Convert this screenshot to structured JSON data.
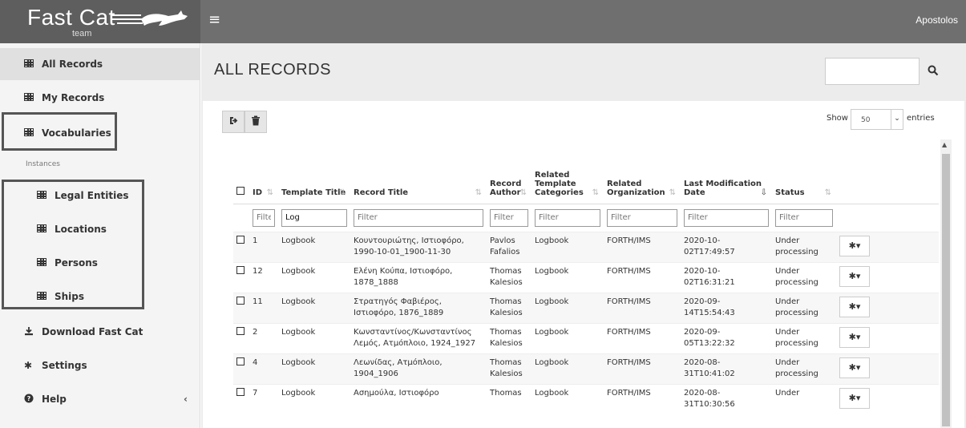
{
  "brand": {
    "name": "Fast Cat",
    "sub": "team"
  },
  "topbar": {
    "menu_icon": "hamburger-icon",
    "user": "Apostolos"
  },
  "sidebar": {
    "items": [
      {
        "label": "All Records",
        "icon": "table-icon"
      },
      {
        "label": "My Records",
        "icon": "table-icon"
      },
      {
        "label": "Vocabularies",
        "icon": "table-icon"
      }
    ],
    "section_label": "Instances",
    "instances": [
      {
        "label": "Legal Entities",
        "icon": "table-icon"
      },
      {
        "label": "Locations",
        "icon": "table-icon"
      },
      {
        "label": "Persons",
        "icon": "table-icon"
      },
      {
        "label": "Ships",
        "icon": "table-icon"
      }
    ],
    "bottom": [
      {
        "label": "Download Fast Cat",
        "icon": "download-icon"
      },
      {
        "label": "Settings",
        "icon": "gear-icon"
      },
      {
        "label": "Help",
        "icon": "question-icon",
        "chevron": "‹"
      }
    ]
  },
  "main": {
    "title": "ALL RECORDS",
    "search": {
      "value": "",
      "placeholder": ""
    },
    "toolbar": {
      "export_icon": "sign-in-icon",
      "delete_icon": "trash-icon"
    },
    "show": {
      "label": "Show",
      "value": "50",
      "suffix": "entries"
    },
    "table": {
      "columns": [
        "",
        "ID",
        "Template Title",
        "Record Title",
        "Record Author",
        "Related Template Categories",
        "Related Organization",
        "Last Modification Date",
        "Status",
        ""
      ],
      "filters": [
        "",
        "Filter",
        "Log",
        "Filter",
        "Filter",
        "Filter",
        "Filter",
        "Filter",
        "Filter",
        ""
      ],
      "rows": [
        {
          "id": "1",
          "template": "Logbook",
          "title": "Κουντουριώτης, Ιστιοφόρο, 1990-10-01_1900-11-30",
          "author": "Pavlos Fafalios",
          "category": "Logbook",
          "org": "FORTH/IMS",
          "date": "2020-10-02T17:49:57",
          "status": "Under processing"
        },
        {
          "id": "12",
          "template": "Logbook",
          "title": "Ελένη Κούπα, Ιστιοφόρο, 1878_1888",
          "author": "Thomas Kalesios",
          "category": "Logbook",
          "org": "FORTH/IMS",
          "date": "2020-10-02T16:31:21",
          "status": "Under processing"
        },
        {
          "id": "11",
          "template": "Logbook",
          "title": "Στρατηγός Φαβιέρος, Ιστιοφόρο, 1876_1889",
          "author": "Thomas Kalesios",
          "category": "Logbook",
          "org": "FORTH/IMS",
          "date": "2020-09-14T15:54:43",
          "status": "Under processing"
        },
        {
          "id": "2",
          "template": "Logbook",
          "title": "Κωνσταντίνος/Κωνσταντίνος Λεμός, Ατμόπλοιο, 1924_1927",
          "author": "Thomas Kalesios",
          "category": "Logbook",
          "org": "FORTH/IMS",
          "date": "2020-09-05T13:22:32",
          "status": "Under processing"
        },
        {
          "id": "4",
          "template": "Logbook",
          "title": "Λεωνίδας, Ατμόπλοιο, 1904_1906",
          "author": "Thomas Kalesios",
          "category": "Logbook",
          "org": "FORTH/IMS",
          "date": "2020-08-31T10:41:02",
          "status": "Under processing"
        },
        {
          "id": "7",
          "template": "Logbook",
          "title": "Ασημούλα, Ιστιοφόρο",
          "author": "Thomas",
          "category": "Logbook",
          "org": "FORTH/IMS",
          "date": "2020-08-31T10:30:56",
          "status": "Under"
        }
      ]
    }
  }
}
